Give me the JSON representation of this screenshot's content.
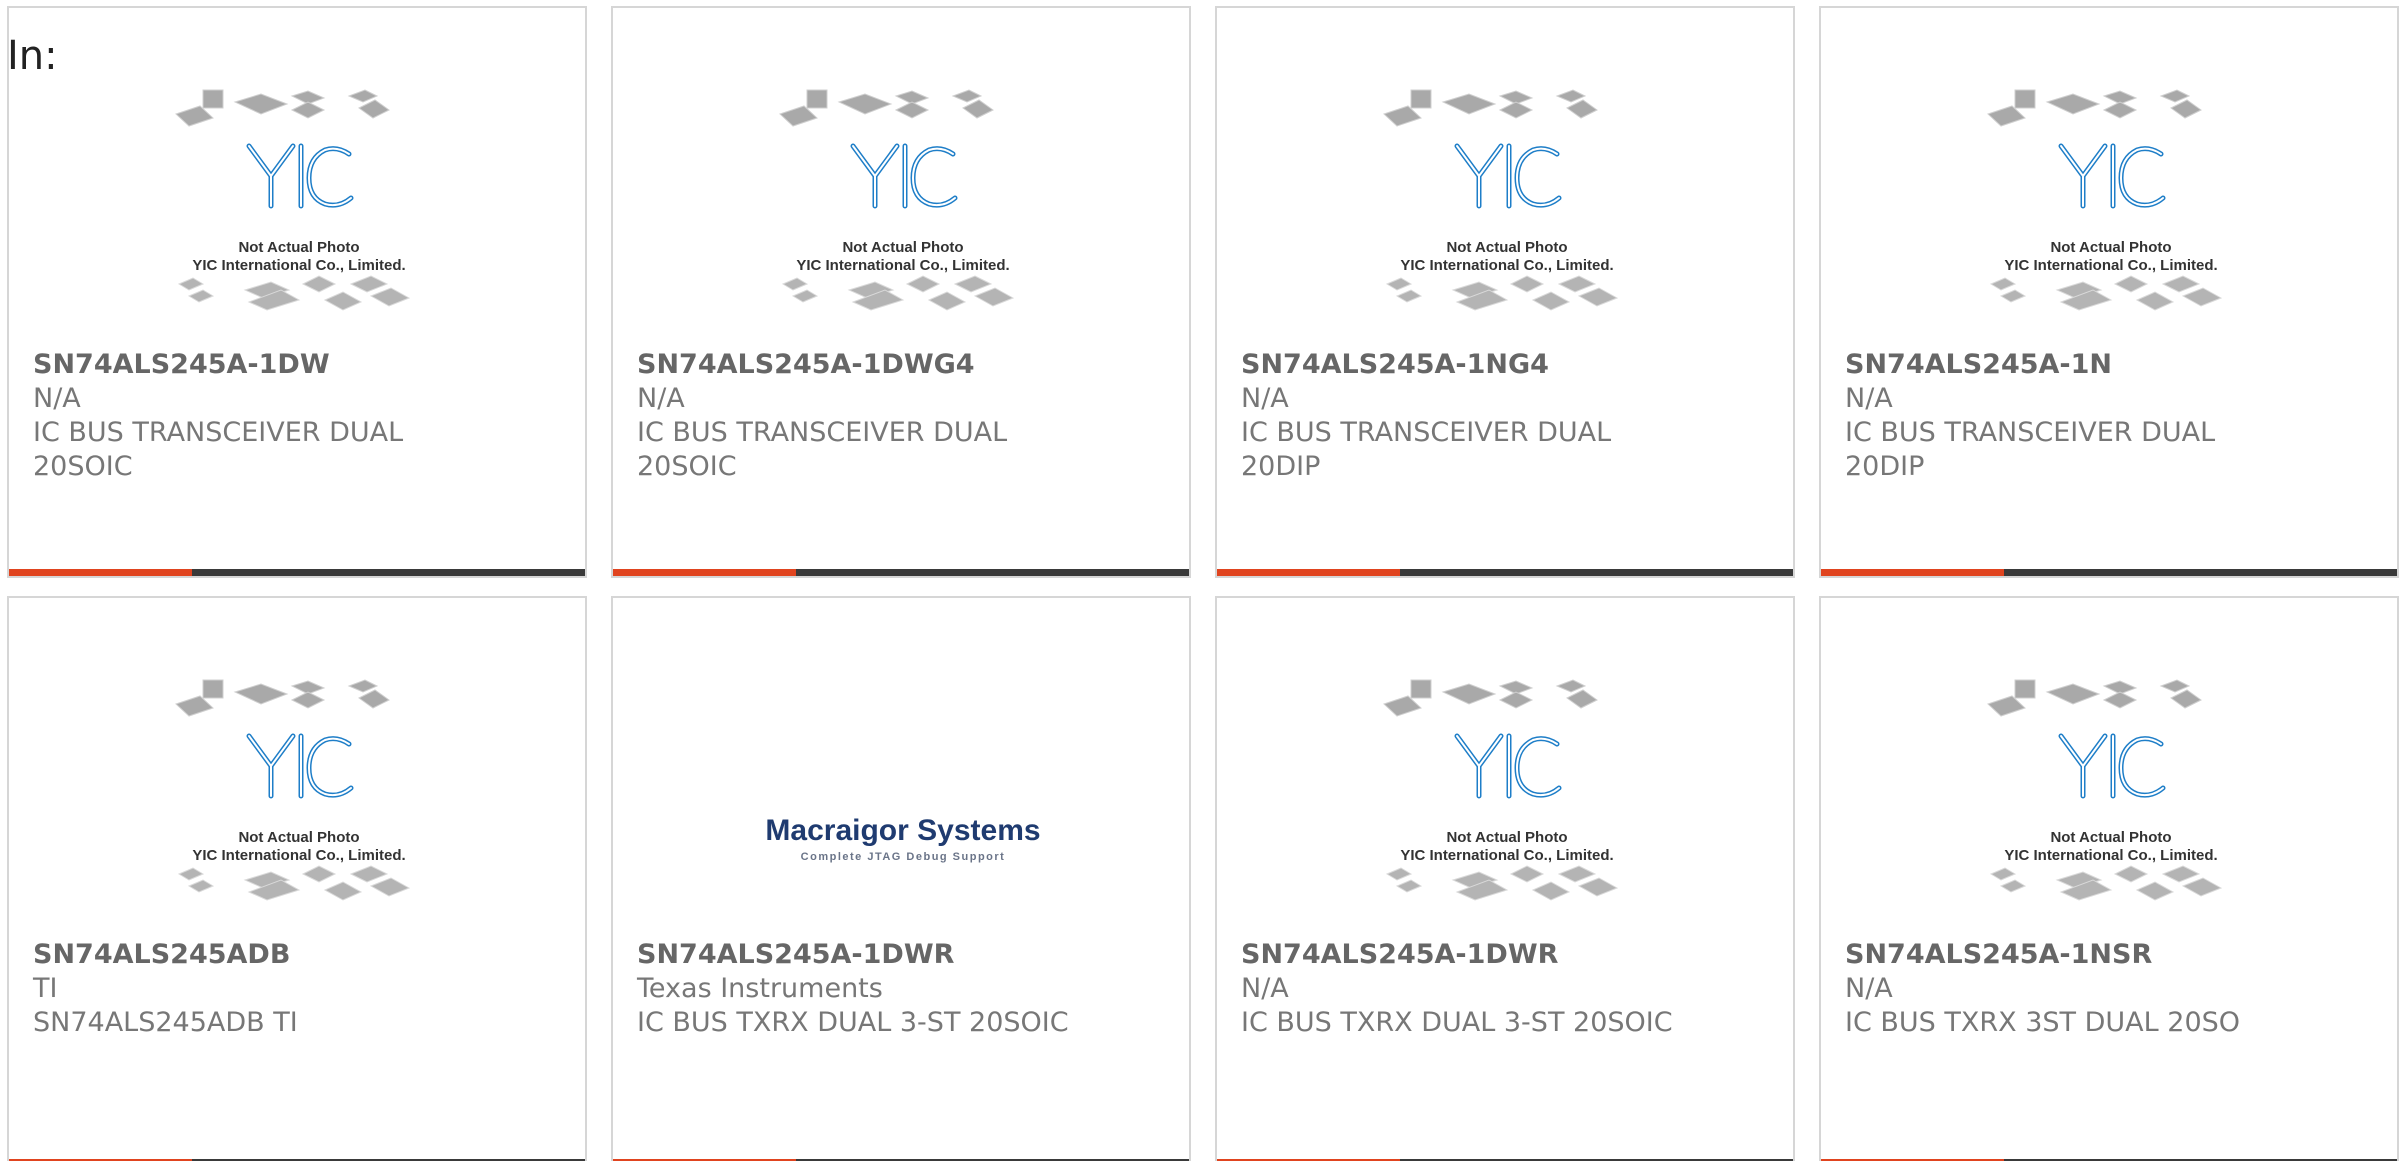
{
  "heading": "In:",
  "placeholder_caption": {
    "line1": "Not Actual Photo",
    "line2": "YIC International Co., Limited."
  },
  "macraigor_caption": {
    "brand": "Macraigor Systems",
    "tagline": "Complete JTAG Debug Support"
  },
  "colors": {
    "accent_orange": "#e0441f",
    "accent_dark": "#3a3a3a",
    "yic_blue": "#1e7ec8"
  },
  "products": [
    {
      "part": "SN74ALS245A-1DW",
      "manufacturer": "N/A",
      "desc1": "IC BUS TRANSCEIVER DUAL",
      "desc2": "20SOIC",
      "image": "yic-placeholder"
    },
    {
      "part": "SN74ALS245A-1DWG4",
      "manufacturer": "N/A",
      "desc1": "IC BUS TRANSCEIVER DUAL",
      "desc2": "20SOIC",
      "image": "yic-placeholder"
    },
    {
      "part": "SN74ALS245A-1NG4",
      "manufacturer": "N/A",
      "desc1": "IC BUS TRANSCEIVER DUAL",
      "desc2": "20DIP",
      "image": "yic-placeholder"
    },
    {
      "part": "SN74ALS245A-1N",
      "manufacturer": "N/A",
      "desc1": "IC BUS TRANSCEIVER DUAL",
      "desc2": "20DIP",
      "image": "yic-placeholder"
    },
    {
      "part": "SN74ALS245ADB",
      "manufacturer": "TI",
      "desc1": "SN74ALS245ADB TI",
      "desc2": "",
      "image": "yic-placeholder"
    },
    {
      "part": "SN74ALS245A-1DWR",
      "manufacturer": "Texas Instruments",
      "desc1": "IC BUS TXRX DUAL 3-ST 20SOIC",
      "desc2": "",
      "image": "macraigor-logo"
    },
    {
      "part": "SN74ALS245A-1DWR",
      "manufacturer": "N/A",
      "desc1": "IC BUS TXRX DUAL 3-ST 20SOIC",
      "desc2": "",
      "image": "yic-placeholder"
    },
    {
      "part": "SN74ALS245A-1NSR",
      "manufacturer": "N/A",
      "desc1": "IC BUS TXRX 3ST DUAL 20SO",
      "desc2": "",
      "image": "yic-placeholder"
    }
  ]
}
